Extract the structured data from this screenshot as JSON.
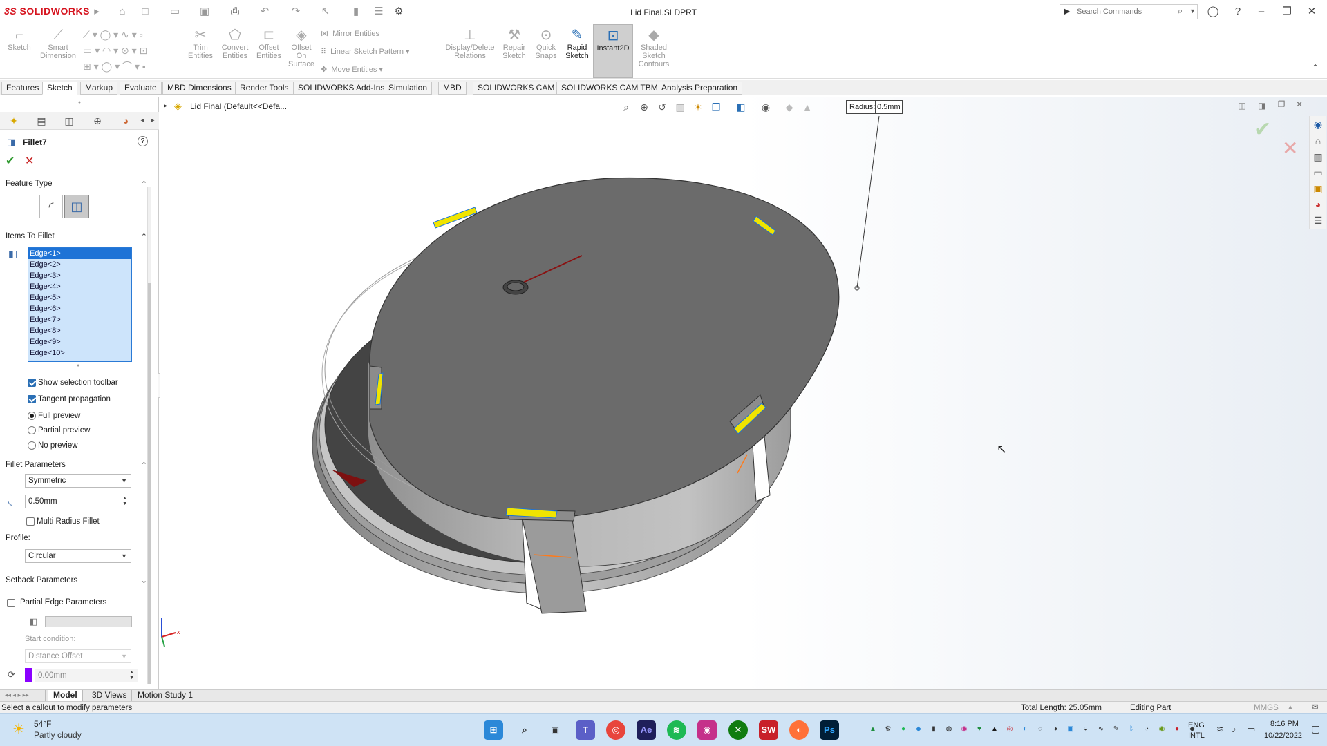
{
  "app": {
    "brand": "SOLIDWORKS",
    "brand_prefix": "3S",
    "doc_title": "Lid Final.SLDPRT"
  },
  "search": {
    "placeholder": "Search Commands"
  },
  "ribbon": {
    "buttons": [
      "Sketch",
      "Smart Dimension",
      "Trim Entities",
      "Convert Entities",
      "Offset Entities",
      "Offset On Surface",
      "Display/Delete Relations",
      "Repair Sketch",
      "Quick Snaps",
      "Rapid Sketch",
      "Instant2D",
      "Shaded Sketch Contours"
    ],
    "small": [
      "Mirror Entities",
      "Linear Sketch Pattern",
      "Move Entities"
    ]
  },
  "tabs": [
    "Features",
    "Sketch",
    "Markup",
    "Evaluate",
    "MBD Dimensions",
    "Render Tools",
    "SOLIDWORKS Add-Ins",
    "Simulation",
    "MBD",
    "SOLIDWORKS CAM",
    "SOLIDWORKS CAM TBM",
    "Analysis Preparation"
  ],
  "tree": {
    "label": "Lid Final  (Default<<Defa..."
  },
  "callout": {
    "label": "Radius:",
    "value": "0.5mm"
  },
  "panel": {
    "title": "Fillet7",
    "feature_type": "Feature Type",
    "items_to_fillet": "Items To Fillet",
    "edges": [
      "Edge<1>",
      "Edge<2>",
      "Edge<3>",
      "Edge<4>",
      "Edge<5>",
      "Edge<6>",
      "Edge<7>",
      "Edge<8>",
      "Edge<9>",
      "Edge<10>"
    ],
    "show_selection_toolbar": "Show selection toolbar",
    "tangent_propagation": "Tangent propagation",
    "full_preview": "Full preview",
    "partial_preview": "Partial preview",
    "no_preview": "No preview",
    "fillet_parameters": "Fillet Parameters",
    "symmetric": "Symmetric",
    "radius": "0.50mm",
    "multi_radius": "Multi Radius Fillet",
    "profile_label": "Profile:",
    "profile": "Circular",
    "setback": "Setback Parameters",
    "partial_edge": "Partial Edge Parameters",
    "start_condition": "Start condition:",
    "distance_offset": "Distance Offset",
    "offset_value": "0.00mm"
  },
  "bottom_tabs": [
    "Model",
    "3D Views",
    "Motion Study 1"
  ],
  "status": {
    "message": "Select a callout to modify parameters",
    "total_length": "Total Length: 25.05mm",
    "mode": "Editing Part",
    "units": "MMGS"
  },
  "taskbar": {
    "temp": "54°F",
    "weather": "Partly cloudy",
    "lang1": "ENG",
    "lang2": "INTL",
    "time": "8:16 PM",
    "date": "10/22/2022"
  },
  "colors": {
    "accent": "#2a6fb5",
    "brand": "#d6141f",
    "fillet_highlight": "#f0e400"
  }
}
